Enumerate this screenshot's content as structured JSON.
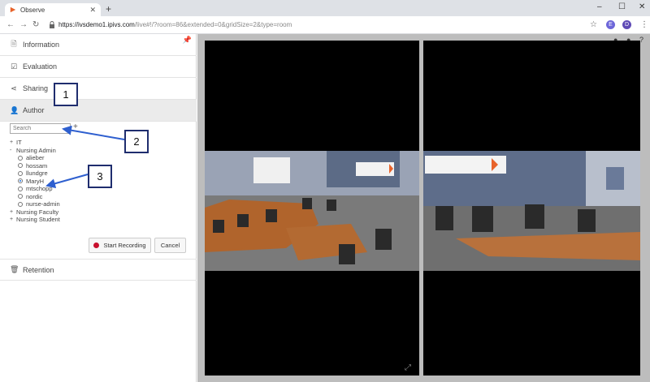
{
  "browser": {
    "tab_title": "Observe",
    "new_tab": "+",
    "url_host": "https://ivsdemo1.ipivs.com",
    "url_rest": "/live#!/?room=86&extended=0&gridSize=2&type=room",
    "avatar_letter": "D",
    "ext_letter": "E",
    "window_controls": [
      "–",
      "☐",
      "✕"
    ]
  },
  "sidebar": {
    "sections": [
      {
        "label": "Information",
        "icon": "document-icon"
      },
      {
        "label": "Evaluation",
        "icon": "checkbox-icon"
      },
      {
        "label": "Sharing",
        "icon": "share-icon"
      },
      {
        "label": "Author",
        "icon": "person-icon"
      },
      {
        "label": "Retention",
        "icon": "trash-icon"
      }
    ],
    "search_placeholder": "Search",
    "tree": [
      {
        "label": "IT",
        "expander": "+"
      },
      {
        "label": "Nursing Admin",
        "expander": "-",
        "children": [
          "alieber",
          "hossam",
          "llundgre",
          "MaryH",
          "mtschopp",
          "nordic",
          "nurse-admin"
        ],
        "selected": "MaryH"
      },
      {
        "label": "Nursing Faculty",
        "expander": "+"
      },
      {
        "label": "Nursing Student",
        "expander": "+"
      }
    ],
    "start_recording_label": "Start Recording",
    "cancel_label": "Cancel"
  },
  "callouts": [
    "1",
    "2",
    "3"
  ],
  "colors": {
    "accent": "#1f2d6e",
    "record": "#c8102e",
    "arrow": "#2e5fcf"
  }
}
